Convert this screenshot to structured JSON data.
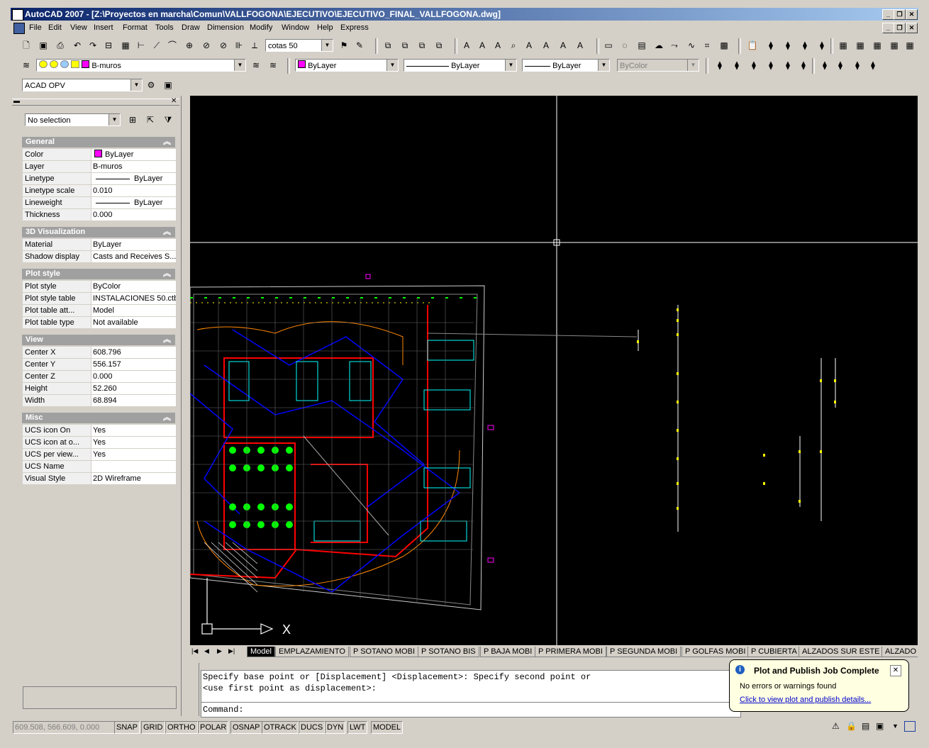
{
  "title": "AutoCAD 2007 - [Z:\\Proyectos en marcha\\Comun\\VALLFOGONA\\EJECUTIVO\\EJECUTIVO_FINAL_VALLFOGONA.dwg]",
  "menu": [
    "File",
    "Edit",
    "View",
    "Insert",
    "Format",
    "Tools",
    "Draw",
    "Dimension",
    "Modify",
    "Window",
    "Help",
    "Express"
  ],
  "toolbar": {
    "dimstyle": "cotas 50",
    "layer": "B-muros",
    "color": "ByLayer",
    "linetype": "ByLayer",
    "lineweight": "ByLayer",
    "plotstyle": "ByColor",
    "workspace": "ACAD OPV"
  },
  "properties": {
    "selection": "No selection",
    "sections": [
      {
        "title": "General",
        "rows": [
          {
            "k": "Color",
            "v": "ByLayer"
          },
          {
            "k": "Layer",
            "v": "B-muros"
          },
          {
            "k": "Linetype",
            "v": "ByLayer"
          },
          {
            "k": "Linetype scale",
            "v": "0.010"
          },
          {
            "k": "Lineweight",
            "v": "ByLayer"
          },
          {
            "k": "Thickness",
            "v": "0.000"
          }
        ]
      },
      {
        "title": "3D Visualization",
        "rows": [
          {
            "k": "Material",
            "v": "ByLayer"
          },
          {
            "k": "Shadow display",
            "v": "Casts and Receives S..."
          }
        ]
      },
      {
        "title": "Plot style",
        "rows": [
          {
            "k": "Plot style",
            "v": "ByColor"
          },
          {
            "k": "Plot style table",
            "v": "INSTALACIONES 50.ctb"
          },
          {
            "k": "Plot table att...",
            "v": "Model"
          },
          {
            "k": "Plot table type",
            "v": "Not available"
          }
        ]
      },
      {
        "title": "View",
        "rows": [
          {
            "k": "Center X",
            "v": "608.796"
          },
          {
            "k": "Center Y",
            "v": "556.157"
          },
          {
            "k": "Center Z",
            "v": "0.000"
          },
          {
            "k": "Height",
            "v": "52.260"
          },
          {
            "k": "Width",
            "v": "68.894"
          }
        ]
      },
      {
        "title": "Misc",
        "rows": [
          {
            "k": "UCS icon On",
            "v": "Yes"
          },
          {
            "k": "UCS icon at o...",
            "v": "Yes"
          },
          {
            "k": "UCS per view...",
            "v": "Yes"
          },
          {
            "k": "UCS Name",
            "v": ""
          },
          {
            "k": "Visual Style",
            "v": "2D Wireframe"
          }
        ]
      }
    ]
  },
  "tabs": [
    "Model",
    "EMPLAZAMIENTO",
    "P SOTANO MOBI",
    "P SOTANO BIS",
    "P BAJA MOBI",
    "P PRIMERA MOBI",
    "P SEGUNDA MOBI",
    "P GOLFAS MOBI",
    "P CUBIERTA",
    "ALZADOS SUR ESTE",
    "ALZADO"
  ],
  "command": {
    "line1": "Specify base point or [Displacement] <Displacement>: Specify second point or",
    "line2": "<use first point as displacement>:",
    "prompt": "Command:"
  },
  "balloon": {
    "title": "Plot and Publish Job Complete",
    "message": "No errors or warnings found",
    "link": "Click to view plot and publish details..."
  },
  "status": {
    "coords": "609.508, 566.609, 0.000",
    "buttons": [
      "SNAP",
      "GRID",
      "ORTHO",
      "POLAR",
      "OSNAP",
      "OTRACK",
      "DUCS",
      "DYN",
      "LWT",
      "MODEL"
    ]
  },
  "ucs_label": "X",
  "colors": {
    "titlebar": "#0a246a",
    "layer_magenta": "#ff00ff",
    "canvas": "#000000"
  }
}
